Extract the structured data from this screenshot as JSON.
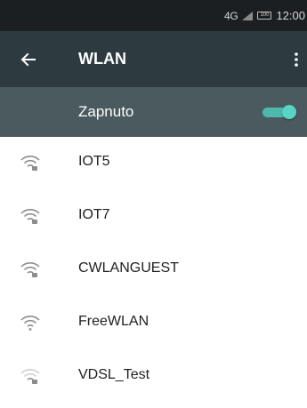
{
  "status_bar": {
    "network": "4G",
    "battery": "100",
    "time": "12:00"
  },
  "app_bar": {
    "title": "WLAN",
    "back_icon": "arrow-left-icon",
    "menu_icon": "more-vertical-icon"
  },
  "wifi_toggle": {
    "label": "Zapnuto",
    "state": "on",
    "accent_color": "#57d4c4"
  },
  "networks": [
    {
      "ssid": "IOT5",
      "icon": "wifi-locked-icon"
    },
    {
      "ssid": "IOT7",
      "icon": "wifi-locked-icon"
    },
    {
      "ssid": "CWLANGUEST",
      "icon": "wifi-locked-icon"
    },
    {
      "ssid": "FreeWLAN",
      "icon": "wifi-open-icon"
    },
    {
      "ssid": "VDSL_Test",
      "icon": "wifi-locked-weak-icon"
    }
  ],
  "colors": {
    "status_bar_bg": "#1c1f22",
    "app_bar_bg": "#2d3b41",
    "toggle_row_bg": "#4a5a5f",
    "brand_mark": "#e9157d"
  }
}
